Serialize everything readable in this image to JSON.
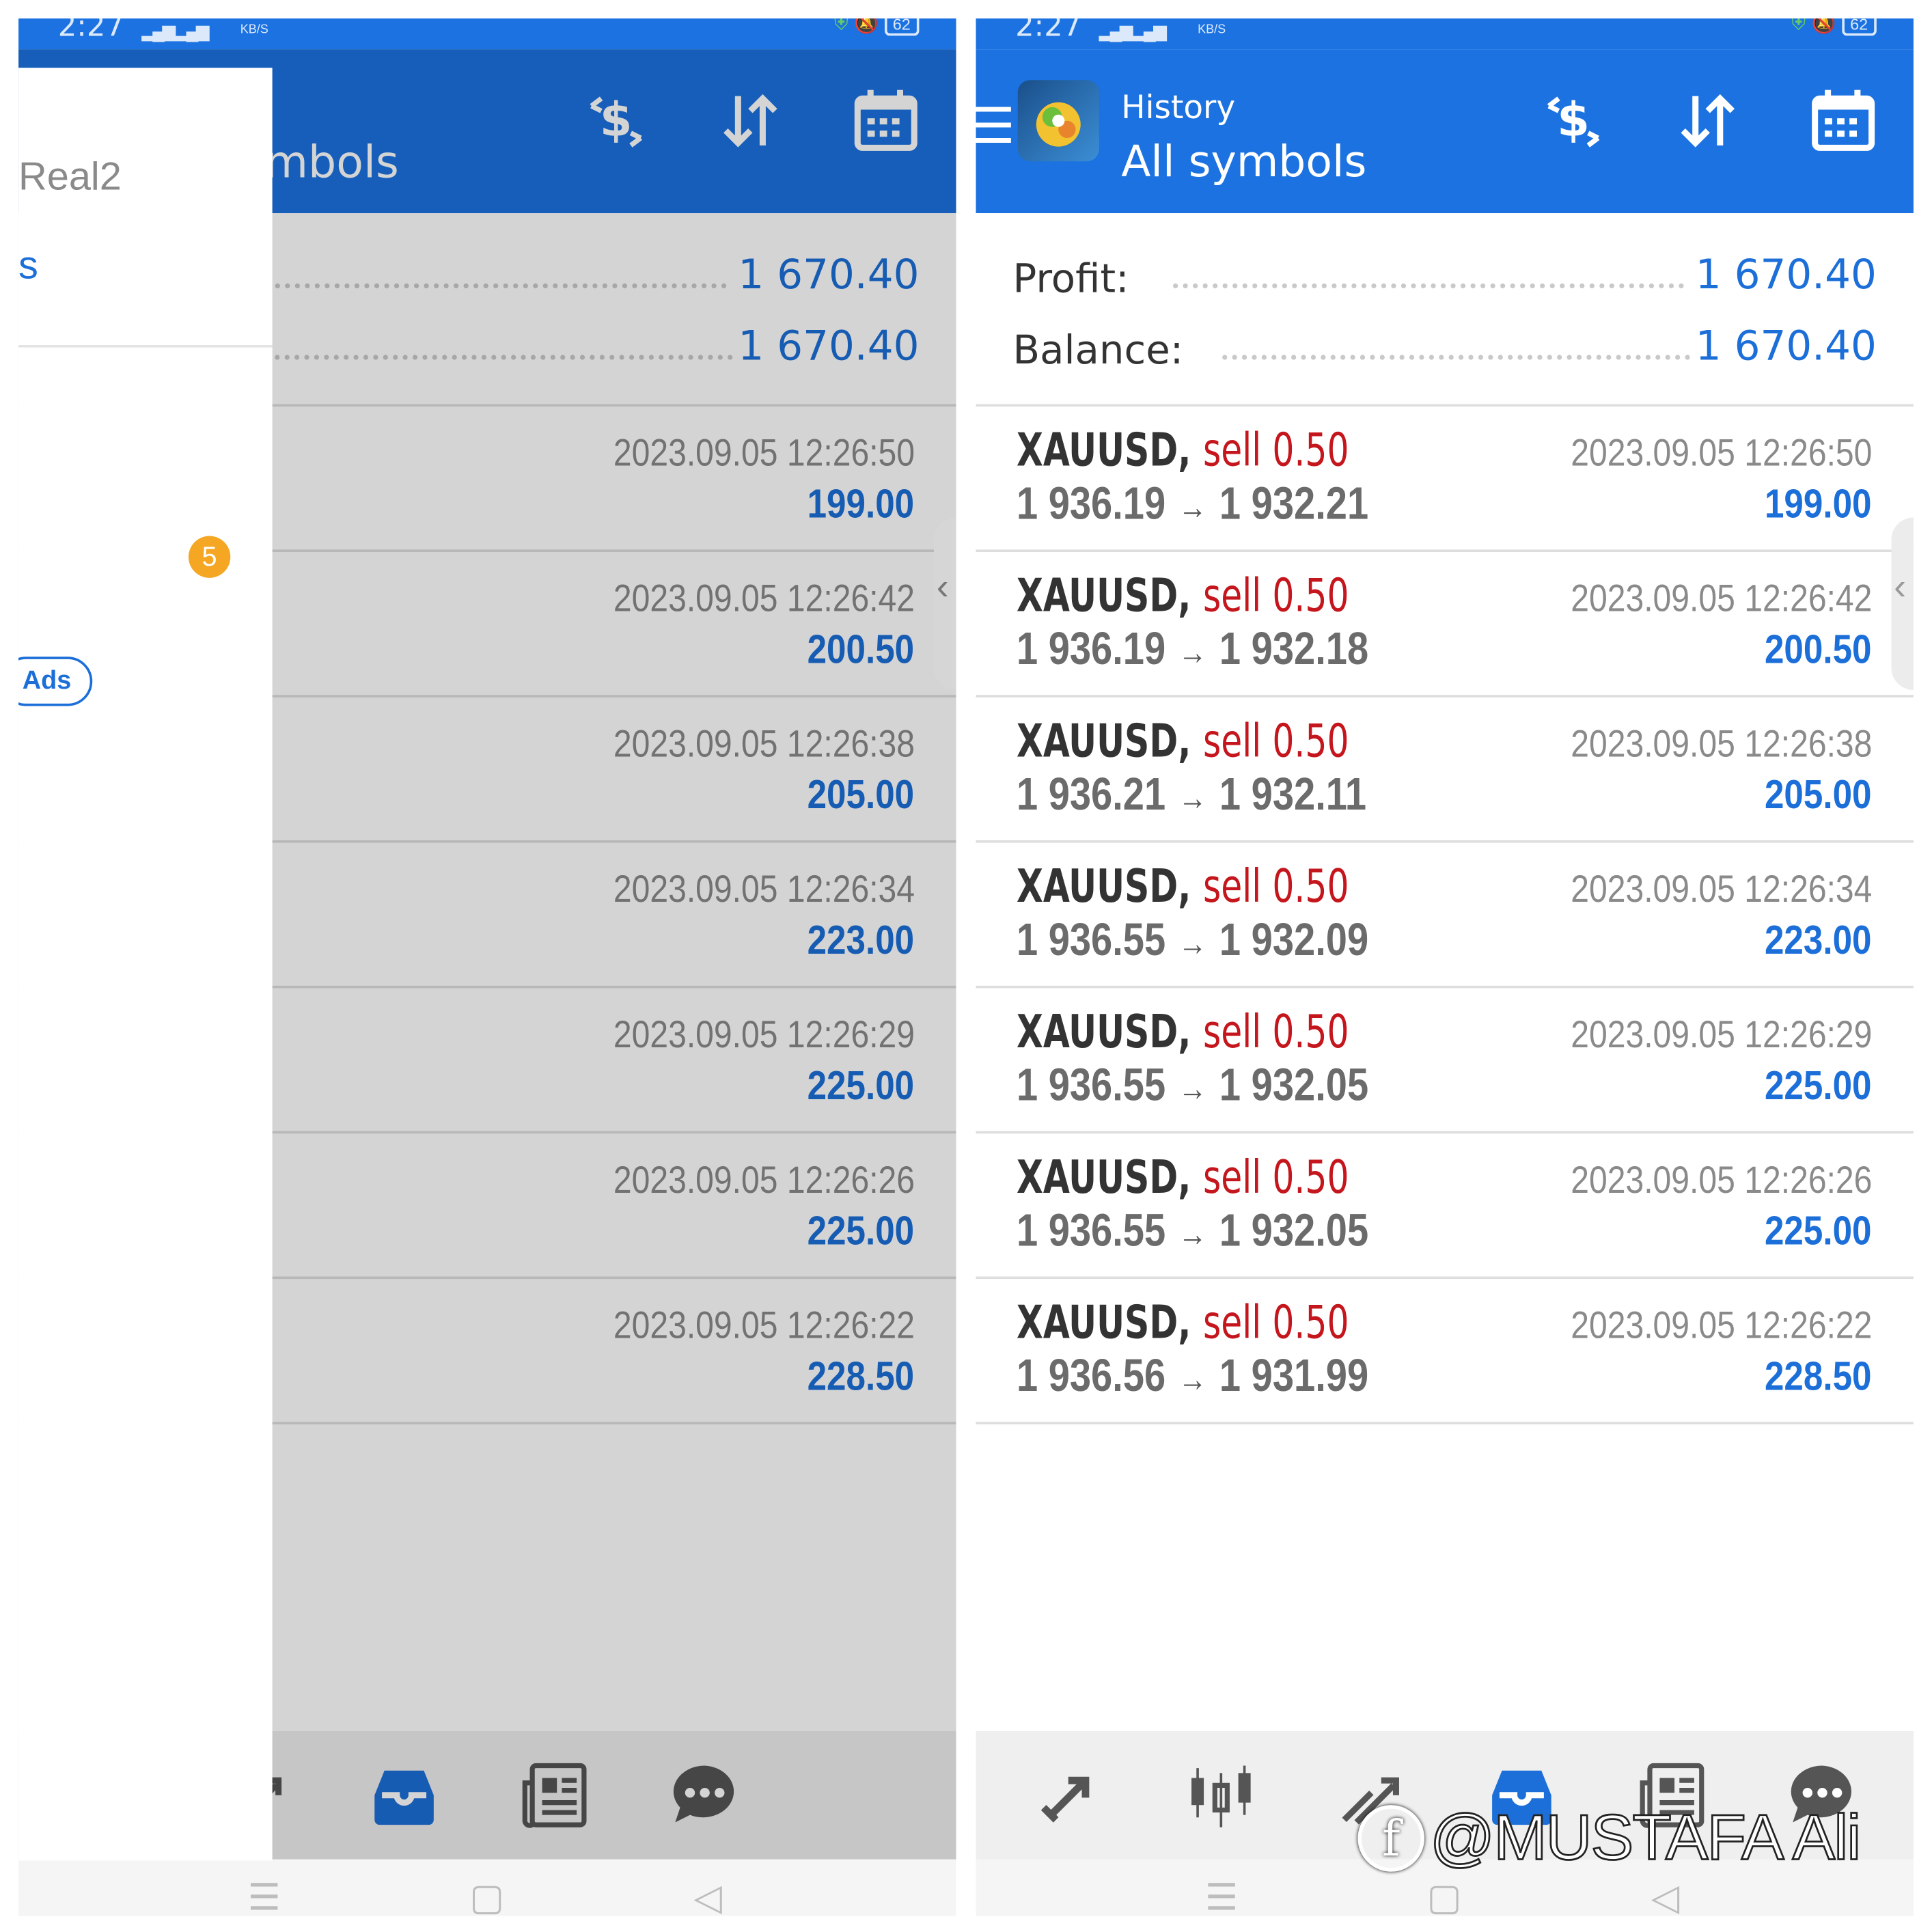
{
  "status_bar": {
    "time": "2:27",
    "speed_unit": "KB/S",
    "battery": "62"
  },
  "header": {
    "title": "History",
    "subtitle": "All symbols",
    "subtitle_partial": "mbols"
  },
  "drawer": {
    "account_partial": "Real2",
    "link_partial": "s",
    "badge": "5",
    "ads_label": "Ads"
  },
  "summary": {
    "profit_label": "Profit:",
    "profit_value": "1 670.40",
    "balance_label": "Balance:",
    "balance_value": "1 670.40"
  },
  "trades": [
    {
      "symbol": "XAUUSD,",
      "side": "sell 0.50",
      "side_partial": "ll 0.50",
      "open": "1 936.19",
      "close": "1 932.21",
      "time": "2023.09.05 12:26:50",
      "profit": "199.00"
    },
    {
      "symbol": "XAUUSD,",
      "side": "sell 0.50",
      "side_partial": "ll 0.50",
      "open": "1 936.19",
      "close": "1 932.18",
      "time": "2023.09.05 12:26:42",
      "profit": "200.50"
    },
    {
      "symbol": "XAUUSD,",
      "side": "sell 0.50",
      "side_partial": "ll 0.50",
      "open": "1 936.21",
      "close": "1 932.11",
      "time": "2023.09.05 12:26:38",
      "profit": "205.00"
    },
    {
      "symbol": "XAUUSD,",
      "side": "sell 0.50",
      "side_partial": "ll 0.50",
      "open": "1 936.55",
      "close": "1 932.09",
      "time": "2023.09.05 12:26:34",
      "profit": "223.00"
    },
    {
      "symbol": "XAUUSD,",
      "side": "sell 0.50",
      "side_partial": "ll 0.50",
      "open": "1 936.55",
      "close": "1 932.05",
      "time": "2023.09.05 12:26:29",
      "profit": "225.00"
    },
    {
      "symbol": "XAUUSD,",
      "side": "sell 0.50",
      "side_partial": "ll 0.50",
      "open": "1 936.55",
      "close": "1 932.05",
      "time": "2023.09.05 12:26:26",
      "profit": "225.00"
    },
    {
      "symbol": "XAUUSD,",
      "side": "sell 0.50",
      "side_partial": "ll 0.50",
      "open": "1 936.56",
      "close": "1 931.99",
      "time": "2023.09.05 12:26:22",
      "profit": "228.50"
    }
  ],
  "watermark": "@MUSTAFA Ali",
  "icons": {
    "header": [
      "currency-exchange-icon",
      "sort-icon",
      "calendar-icon"
    ],
    "nav": [
      "quotes-icon",
      "chart-icon",
      "trade-icon",
      "history-icon",
      "news-icon",
      "chat-icon"
    ],
    "system_nav": [
      "recents-icon",
      "home-icon",
      "back-icon"
    ]
  },
  "colors": {
    "accent": "#1b72e0",
    "sell": "#c4161c",
    "profit": "#1c6fd8"
  }
}
